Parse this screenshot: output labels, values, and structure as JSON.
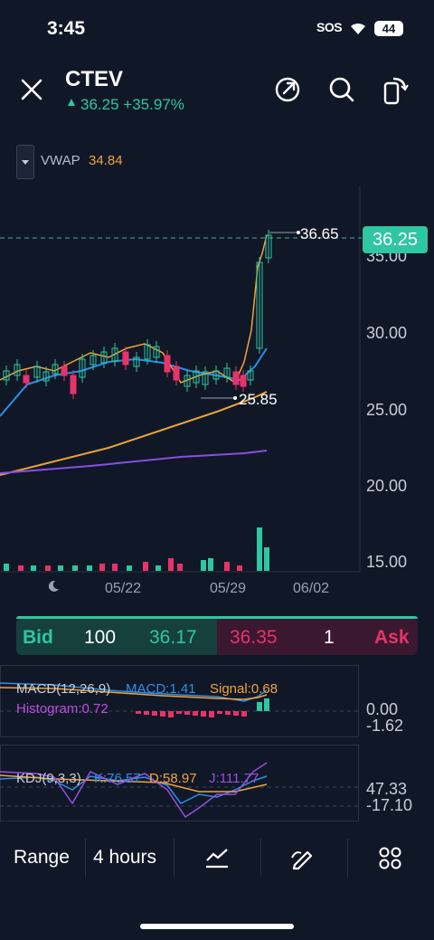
{
  "status": {
    "time": "3:45",
    "carrier": "SOS",
    "battery": "44"
  },
  "header": {
    "ticker": "CTEV",
    "price_line": "36.25 +35.97%"
  },
  "indicator": {
    "label": "VWAP",
    "value": "34.84"
  },
  "chart_data": {
    "type": "candlestick",
    "y_ticks": [
      "35.00",
      "30.00",
      "25.00",
      "20.00",
      "15.00"
    ],
    "x_ticks": [
      "05/22",
      "05/29",
      "06/02"
    ],
    "last_price": "36.25",
    "high_annotation": "36.65",
    "low_annotation": "25.85",
    "colors": {
      "up": "#2fc6a2",
      "down": "#e8336a",
      "vwap": "#f2a33a",
      "ma1": "#2e8de6",
      "ma2": "#e8a33a",
      "ma3": "#8a4ee0"
    }
  },
  "quote": {
    "bid_label": "Bid",
    "bid_size": "100",
    "bid_price": "36.17",
    "ask_price": "36.35",
    "ask_size": "1",
    "ask_label": "Ask"
  },
  "macd": {
    "label": "MACD(12,26,9)",
    "macd": "MACD:1.41",
    "signal": "Signal:0.68",
    "histogram": "Histogram:0.72",
    "axis_top": "0.00",
    "axis_bottom": "-1.62"
  },
  "kdj": {
    "label": "KDJ(9,3,3)",
    "k": "K:76.57",
    "d": "D:58.97",
    "j": "J:111.77",
    "axis_top": "47.33",
    "axis_bottom": "-17.10"
  },
  "toolbar": {
    "range": "Range",
    "interval": "4 hours"
  }
}
